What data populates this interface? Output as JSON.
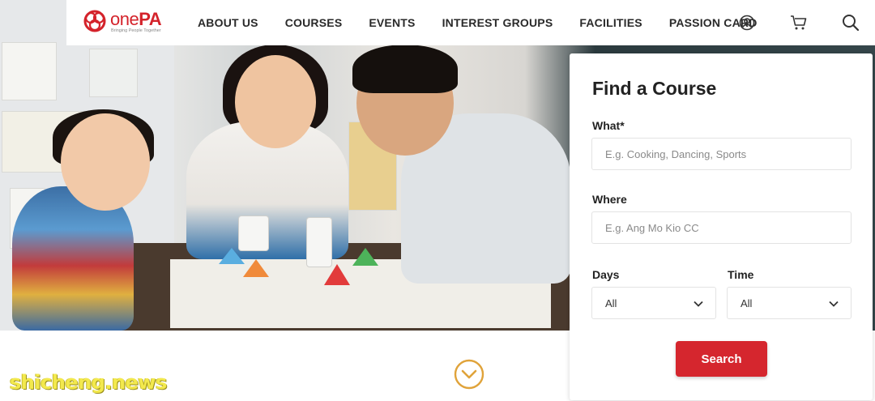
{
  "brand": {
    "name_one": "one",
    "name_pa": "PA",
    "tagline": "Bringing People Together",
    "logo_color": "#d4232b"
  },
  "nav": {
    "items": [
      {
        "label": "ABOUT US"
      },
      {
        "label": "COURSES"
      },
      {
        "label": "EVENTS"
      },
      {
        "label": "INTEREST GROUPS"
      },
      {
        "label": "FACILITIES"
      },
      {
        "label": "PASSION CARD"
      }
    ],
    "icons": [
      "user-icon",
      "cart-icon",
      "search-icon"
    ]
  },
  "finder": {
    "title": "Find a Course",
    "what_label": "What*",
    "what_placeholder": "E.g. Cooking, Dancing, Sports",
    "where_label": "Where",
    "where_placeholder": "E.g. Ang Mo Kio CC",
    "days_label": "Days",
    "days_value": "All",
    "time_label": "Time",
    "time_value": "All",
    "search_label": "Search",
    "button_color": "#d5262e"
  },
  "scroll": {
    "icon": "chevron-down-circle-icon",
    "color": "#e0a33a"
  },
  "watermark": {
    "text": "shicheng.news"
  }
}
